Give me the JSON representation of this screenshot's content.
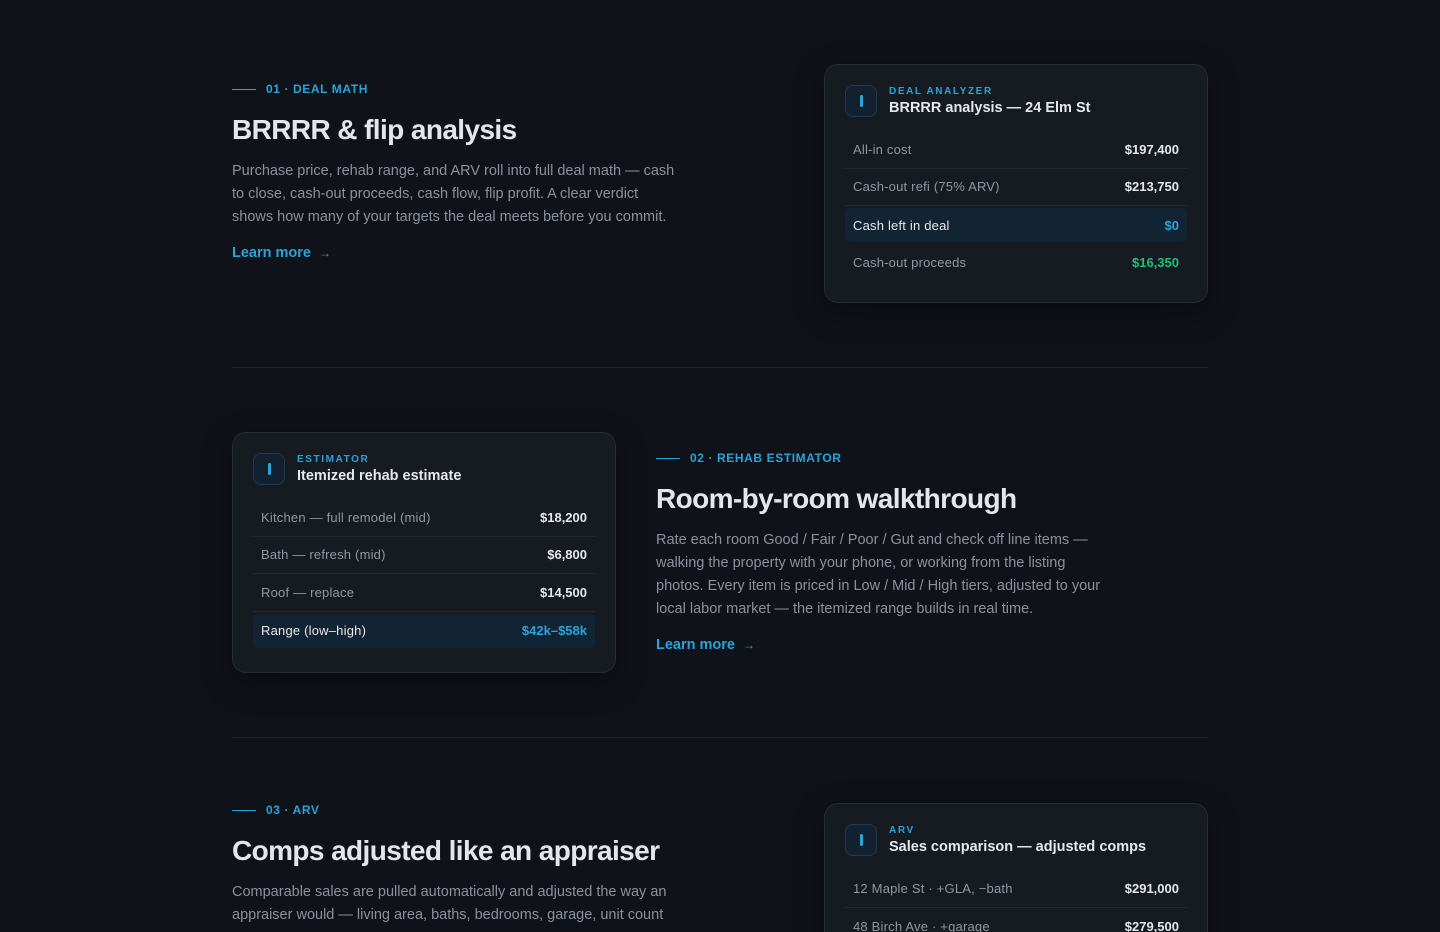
{
  "sections": [
    {
      "eyebrow": "01 · DEAL MATH",
      "title": "BRRRR & flip analysis",
      "description": "Purchase price, rehab range, and ARV roll into full deal math — cash to close, cash-out proceeds, cash flow, flip profit. A clear verdict shows how many of your targets the deal meets before you commit.",
      "learn_more": "Learn more",
      "arrow": "→",
      "card": {
        "kicker": "DEAL ANALYZER",
        "title": "BRRRR analysis — 24 Elm St",
        "rows": [
          {
            "label": "All-in cost",
            "value": "$197,400"
          },
          {
            "label": "Cash-out refi (75% ARV)",
            "value": "$213,750"
          },
          {
            "label": "Cash left in deal",
            "value": "$0"
          },
          {
            "label": "Cash-out proceeds",
            "value": "$16,350"
          }
        ]
      }
    },
    {
      "eyebrow": "02 · REHAB ESTIMATOR",
      "title": "Room-by-room walkthrough",
      "description": "Rate each room Good / Fair / Poor / Gut and check off line items — walking the property with your phone, or working from the listing photos. Every item is priced in Low / Mid / High tiers, adjusted to your local labor market — the itemized range builds in real time.",
      "learn_more": "Learn more",
      "arrow": "→",
      "card": {
        "kicker": "ESTIMATOR",
        "title": "Itemized rehab estimate",
        "rows": [
          {
            "label": "Kitchen — full remodel (mid)",
            "value": "$18,200"
          },
          {
            "label": "Bath — refresh (mid)",
            "value": "$6,800"
          },
          {
            "label": "Roof — replace",
            "value": "$14,500"
          },
          {
            "label": "Range (low–high)",
            "value": "$42k–$58k"
          }
        ]
      }
    },
    {
      "eyebrow": "03 · ARV",
      "title": "Comps adjusted like an appraiser",
      "description": "Comparable sales are pulled automatically and adjusted the way an appraiser would — living area, baths, bedrooms, garage, unit count",
      "card": {
        "kicker": "ARV",
        "title": "Sales comparison — adjusted comps",
        "rows": [
          {
            "label": "12 Maple St · +GLA, −bath",
            "value": "$291,000"
          },
          {
            "label": "48 Birch Ave · +garage",
            "value": "$279,500"
          }
        ]
      }
    }
  ],
  "colors": {
    "accent": "#2aa4d8",
    "positive": "#22c07a",
    "background": "#0f1218"
  }
}
